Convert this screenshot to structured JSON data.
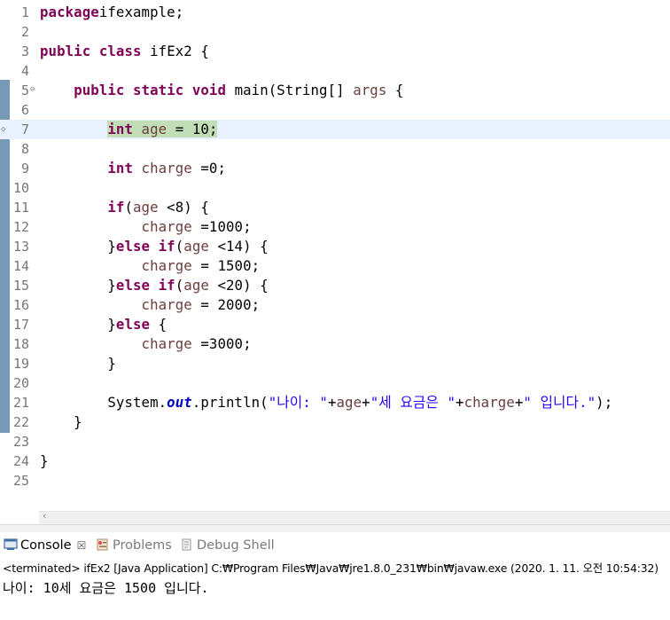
{
  "editor": {
    "lines": [
      {
        "n": "1",
        "tokens": [
          [
            "kw",
            "package"
          ],
          [
            "",
            "ifexample;"
          ]
        ]
      },
      {
        "n": "2",
        "tokens": []
      },
      {
        "n": "3",
        "tokens": [
          [
            "kw",
            "public"
          ],
          [
            "",
            " "
          ],
          [
            "kw",
            "class"
          ],
          [
            "",
            " ifEx2 {"
          ]
        ]
      },
      {
        "n": "4",
        "tokens": []
      },
      {
        "n": "5",
        "fold": "⊖",
        "tokens": [
          [
            "",
            "    "
          ],
          [
            "kw",
            "public"
          ],
          [
            "",
            " "
          ],
          [
            "kw",
            "static"
          ],
          [
            "",
            " "
          ],
          [
            "kw",
            "void"
          ],
          [
            "",
            " main(String[] "
          ],
          [
            "var",
            "args"
          ],
          [
            "",
            " {"
          ]
        ]
      },
      {
        "n": "6",
        "tokens": []
      },
      {
        "n": "7",
        "highlight": true,
        "bp": "◇",
        "tokens": [
          [
            "",
            "        "
          ],
          [
            "sel-kw",
            "int"
          ],
          [
            "sel",
            " "
          ],
          [
            "sel-var",
            "age"
          ],
          [
            "sel",
            " = 10;"
          ]
        ]
      },
      {
        "n": "8",
        "tokens": []
      },
      {
        "n": "9",
        "tokens": [
          [
            "",
            "        "
          ],
          [
            "kw",
            "int"
          ],
          [
            "",
            " "
          ],
          [
            "var",
            "charge"
          ],
          [
            "",
            " =0;"
          ]
        ]
      },
      {
        "n": "10",
        "tokens": []
      },
      {
        "n": "11",
        "tokens": [
          [
            "",
            "        "
          ],
          [
            "kw",
            "if"
          ],
          [
            "",
            "("
          ],
          [
            "var",
            "age"
          ],
          [
            "",
            " <8) {"
          ]
        ]
      },
      {
        "n": "12",
        "tokens": [
          [
            "",
            "            "
          ],
          [
            "var",
            "charge"
          ],
          [
            "",
            " =1000;"
          ]
        ]
      },
      {
        "n": "13",
        "tokens": [
          [
            "",
            "        }"
          ],
          [
            "kw",
            "else"
          ],
          [
            "",
            " "
          ],
          [
            "kw",
            "if"
          ],
          [
            "",
            "("
          ],
          [
            "var",
            "age"
          ],
          [
            "",
            " <14) {"
          ]
        ]
      },
      {
        "n": "14",
        "tokens": [
          [
            "",
            "            "
          ],
          [
            "var",
            "charge"
          ],
          [
            "",
            " = 1500;"
          ]
        ]
      },
      {
        "n": "15",
        "tokens": [
          [
            "",
            "        }"
          ],
          [
            "kw",
            "else"
          ],
          [
            "",
            " "
          ],
          [
            "kw",
            "if"
          ],
          [
            "",
            "("
          ],
          [
            "var",
            "age"
          ],
          [
            "",
            " <20) {"
          ]
        ]
      },
      {
        "n": "16",
        "tokens": [
          [
            "",
            "            "
          ],
          [
            "var",
            "charge"
          ],
          [
            "",
            " = 2000;"
          ]
        ]
      },
      {
        "n": "17",
        "tokens": [
          [
            "",
            "        }"
          ],
          [
            "kw",
            "else"
          ],
          [
            "",
            " {"
          ]
        ]
      },
      {
        "n": "18",
        "tokens": [
          [
            "",
            "            "
          ],
          [
            "var",
            "charge"
          ],
          [
            "",
            " =3000;"
          ]
        ]
      },
      {
        "n": "19",
        "tokens": [
          [
            "",
            "        }"
          ]
        ]
      },
      {
        "n": "20",
        "tokens": []
      },
      {
        "n": "21",
        "tokens": [
          [
            "",
            "        System."
          ],
          [
            "fld",
            "out"
          ],
          [
            "",
            ".println("
          ],
          [
            "str",
            "\"나이: \""
          ],
          [
            "",
            "+"
          ],
          [
            "var",
            "age"
          ],
          [
            "",
            "+"
          ],
          [
            "str",
            "\"세 요금은 \""
          ],
          [
            "",
            "+"
          ],
          [
            "var",
            "charge"
          ],
          [
            "",
            "+"
          ],
          [
            "str",
            "\" 입니다.\""
          ],
          [
            "",
            ");"
          ]
        ]
      },
      {
        "n": "22",
        "tokens": [
          [
            "",
            "    }"
          ]
        ]
      },
      {
        "n": "23",
        "tokens": []
      },
      {
        "n": "24",
        "tokens": [
          [
            "",
            "}"
          ]
        ]
      },
      {
        "n": "25",
        "tokens": []
      }
    ]
  },
  "console": {
    "tabs": [
      {
        "label": "Console",
        "icon": "console-icon",
        "close": "☒"
      },
      {
        "label": "Problems",
        "icon": "problems-icon"
      },
      {
        "label": "Debug Shell",
        "icon": "debug-shell-icon"
      }
    ],
    "status": "<terminated> ifEx2 [Java Application] C:₩Program Files₩Java₩jre1.8.0_231₩bin₩javaw.exe (2020. 1. 11. 오전 10:54:32)",
    "output": "나이: 10세 요금은 1500 입니다."
  },
  "colors": {
    "keyword": "#7f0055",
    "variable": "#6a3e3e",
    "string": "#2a00ff",
    "field": "#0000c0",
    "current_line": "#e8f2fe",
    "selection": "#c2deb6"
  }
}
